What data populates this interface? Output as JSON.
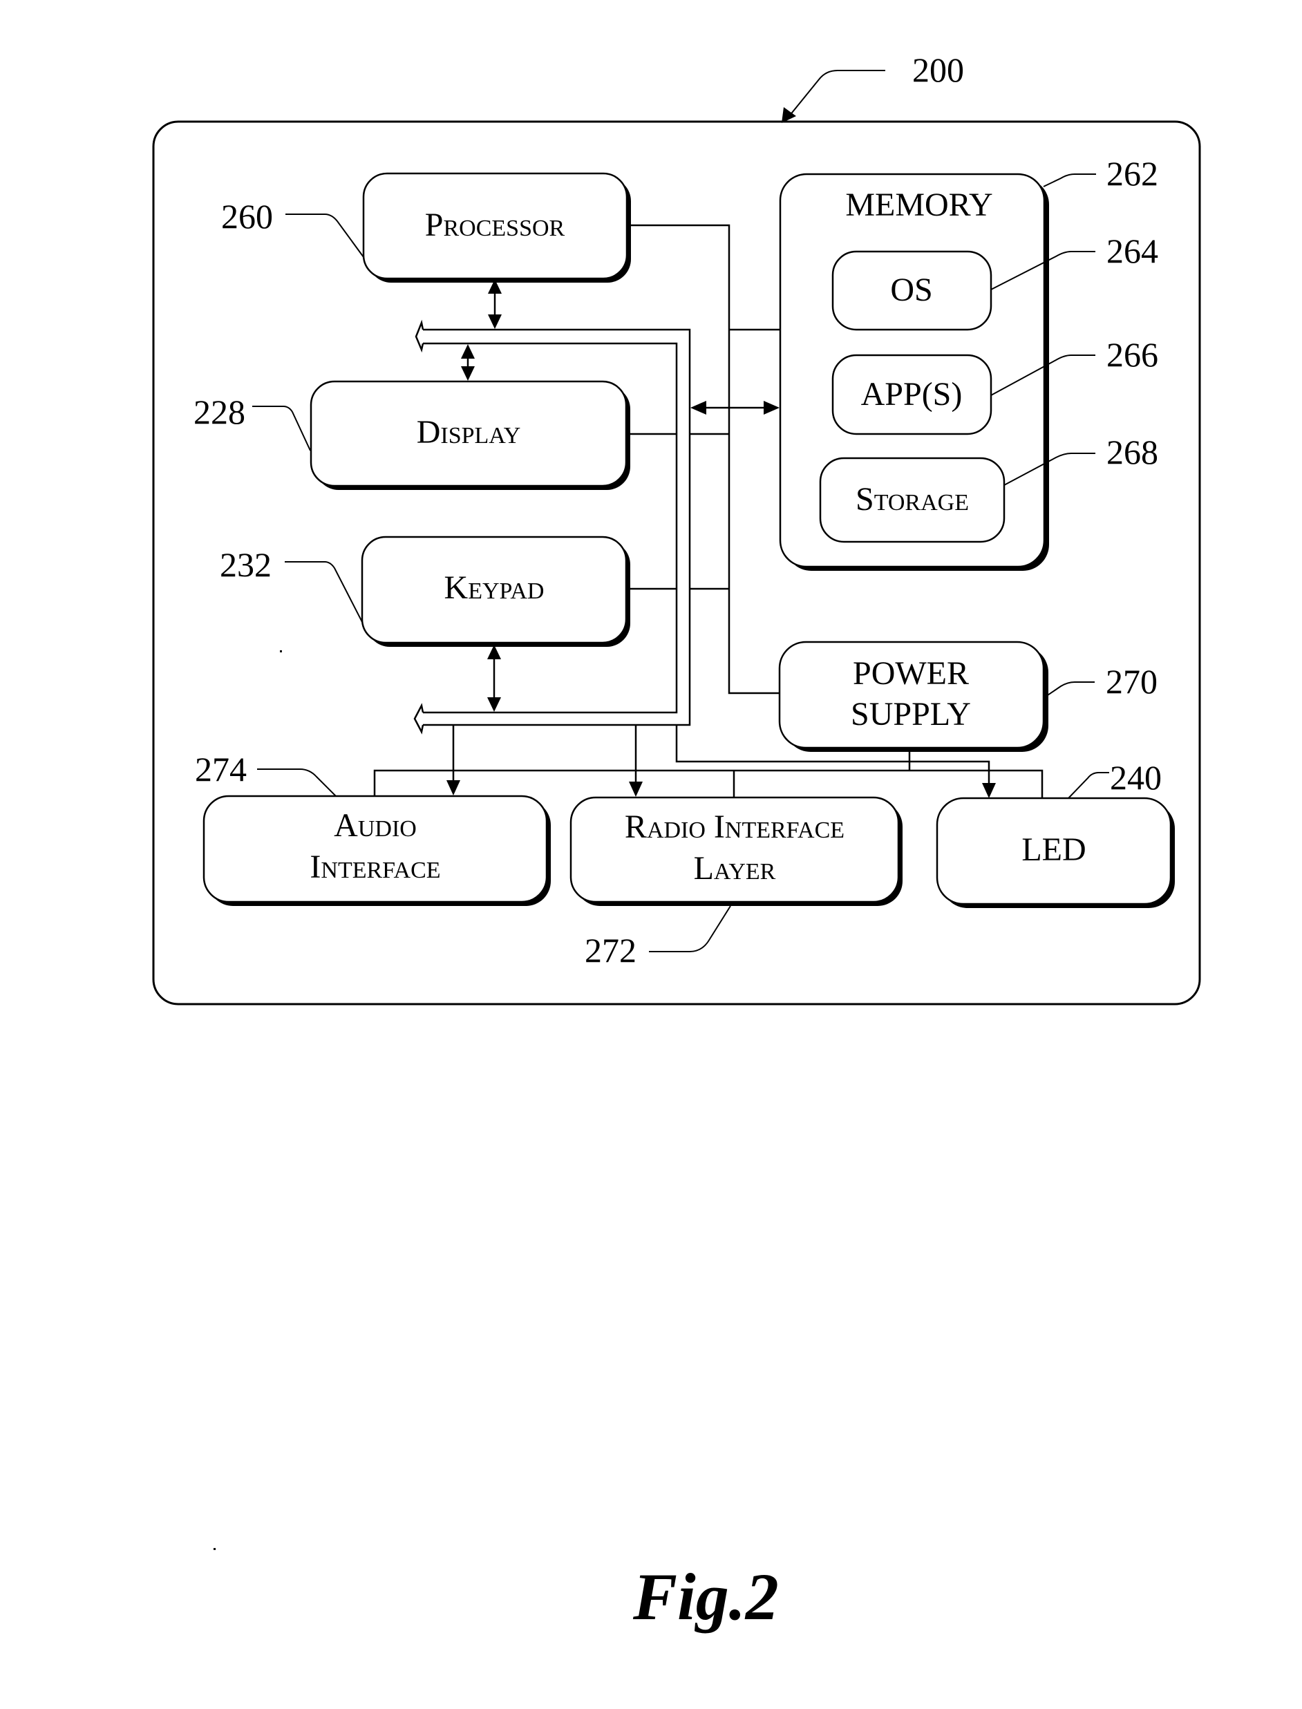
{
  "figure": {
    "caption": "Fig.2",
    "device_ref": "200"
  },
  "components": {
    "processor": {
      "label": "Processor",
      "ref": "260"
    },
    "display": {
      "label": "Display",
      "ref": "228"
    },
    "keypad": {
      "label": "Keypad",
      "ref": "232"
    },
    "memory": {
      "label": "MEMORY",
      "ref": "262"
    },
    "os": {
      "label": "OS",
      "ref": "264"
    },
    "apps": {
      "label": "APP(S)",
      "ref": "266"
    },
    "storage": {
      "label": "Storage",
      "ref": "268"
    },
    "power_supply": {
      "label_lines": [
        "POWER",
        "SUPPLY"
      ],
      "ref": "270"
    },
    "audio_interface": {
      "label_lines": [
        "Audio",
        "Interface"
      ],
      "ref": "274"
    },
    "radio_interface_layer": {
      "label_lines": [
        "Radio Interface",
        "Layer"
      ],
      "ref": "272"
    },
    "led": {
      "label": "LED",
      "ref": "240"
    }
  }
}
